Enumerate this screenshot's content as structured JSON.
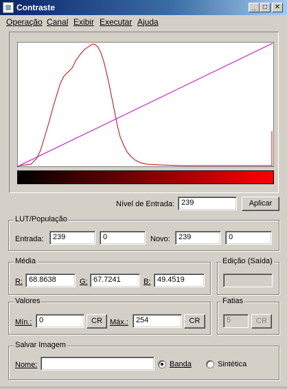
{
  "window": {
    "title": "Contraste",
    "minimize": "_",
    "maximize": "□",
    "close": "✕"
  },
  "menu": [
    "Operação",
    "Canal",
    "Exibir",
    "Executar",
    "Ajuda"
  ],
  "histogram": {
    "curve_color": "#cc0000",
    "lut_color": "#cc00cc",
    "gradient_start": "#000000",
    "gradient_end": "#ff0000"
  },
  "input_level": {
    "label": "Nível de Entrada:",
    "value": "239",
    "apply_button": "Aplicar"
  },
  "lut": {
    "legend": "LUT/População",
    "entrada_label": "Entrada:",
    "entrada_value": "239",
    "entrada_pop": "0",
    "novo_label": "Novo:",
    "novo_value": "239",
    "novo_pop": "0"
  },
  "media": {
    "legend": "Média",
    "r_label": "R:",
    "r_value": "68.8638",
    "g_label": "G:",
    "g_value": "67.7241",
    "b_label": "B:",
    "b_value": "49.4519"
  },
  "edicao": {
    "legend": "Edição (Saída)",
    "value": ""
  },
  "valores": {
    "legend": "Valores",
    "min_label": "Mín.:",
    "min_value": "0",
    "min_button": "CR",
    "max_label": "Máx.:",
    "max_value": "254",
    "max_button": "CR"
  },
  "fatias": {
    "legend": "Fatias",
    "value": "5",
    "button": "CR"
  },
  "salvar": {
    "legend": "Salvar Imagem",
    "nome_label": "Nome:",
    "nome_value": "",
    "option_banda": "Banda",
    "option_sintetica": "Sintética",
    "selected": "Banda"
  }
}
